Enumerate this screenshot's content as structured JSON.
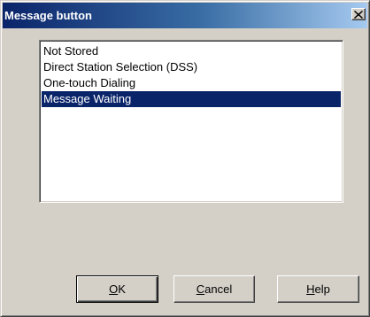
{
  "window": {
    "title": "Message button",
    "close_symbol": "×"
  },
  "listbox": {
    "items": [
      {
        "label": "Not Stored",
        "selected": false
      },
      {
        "label": "Direct Station Selection (DSS)",
        "selected": false
      },
      {
        "label": "One-touch Dialing",
        "selected": false
      },
      {
        "label": "Message Waiting",
        "selected": true
      }
    ]
  },
  "buttons": {
    "ok": {
      "mnemonic": "O",
      "rest": "K"
    },
    "cancel": {
      "mnemonic": "C",
      "rest": "ancel"
    },
    "help": {
      "mnemonic": "H",
      "rest": "elp"
    }
  },
  "colors": {
    "title_bar_start": "#0a246a",
    "title_bar_end": "#a6caf0",
    "selection": "#0a246a",
    "dialog_face": "#d4d0c8"
  }
}
